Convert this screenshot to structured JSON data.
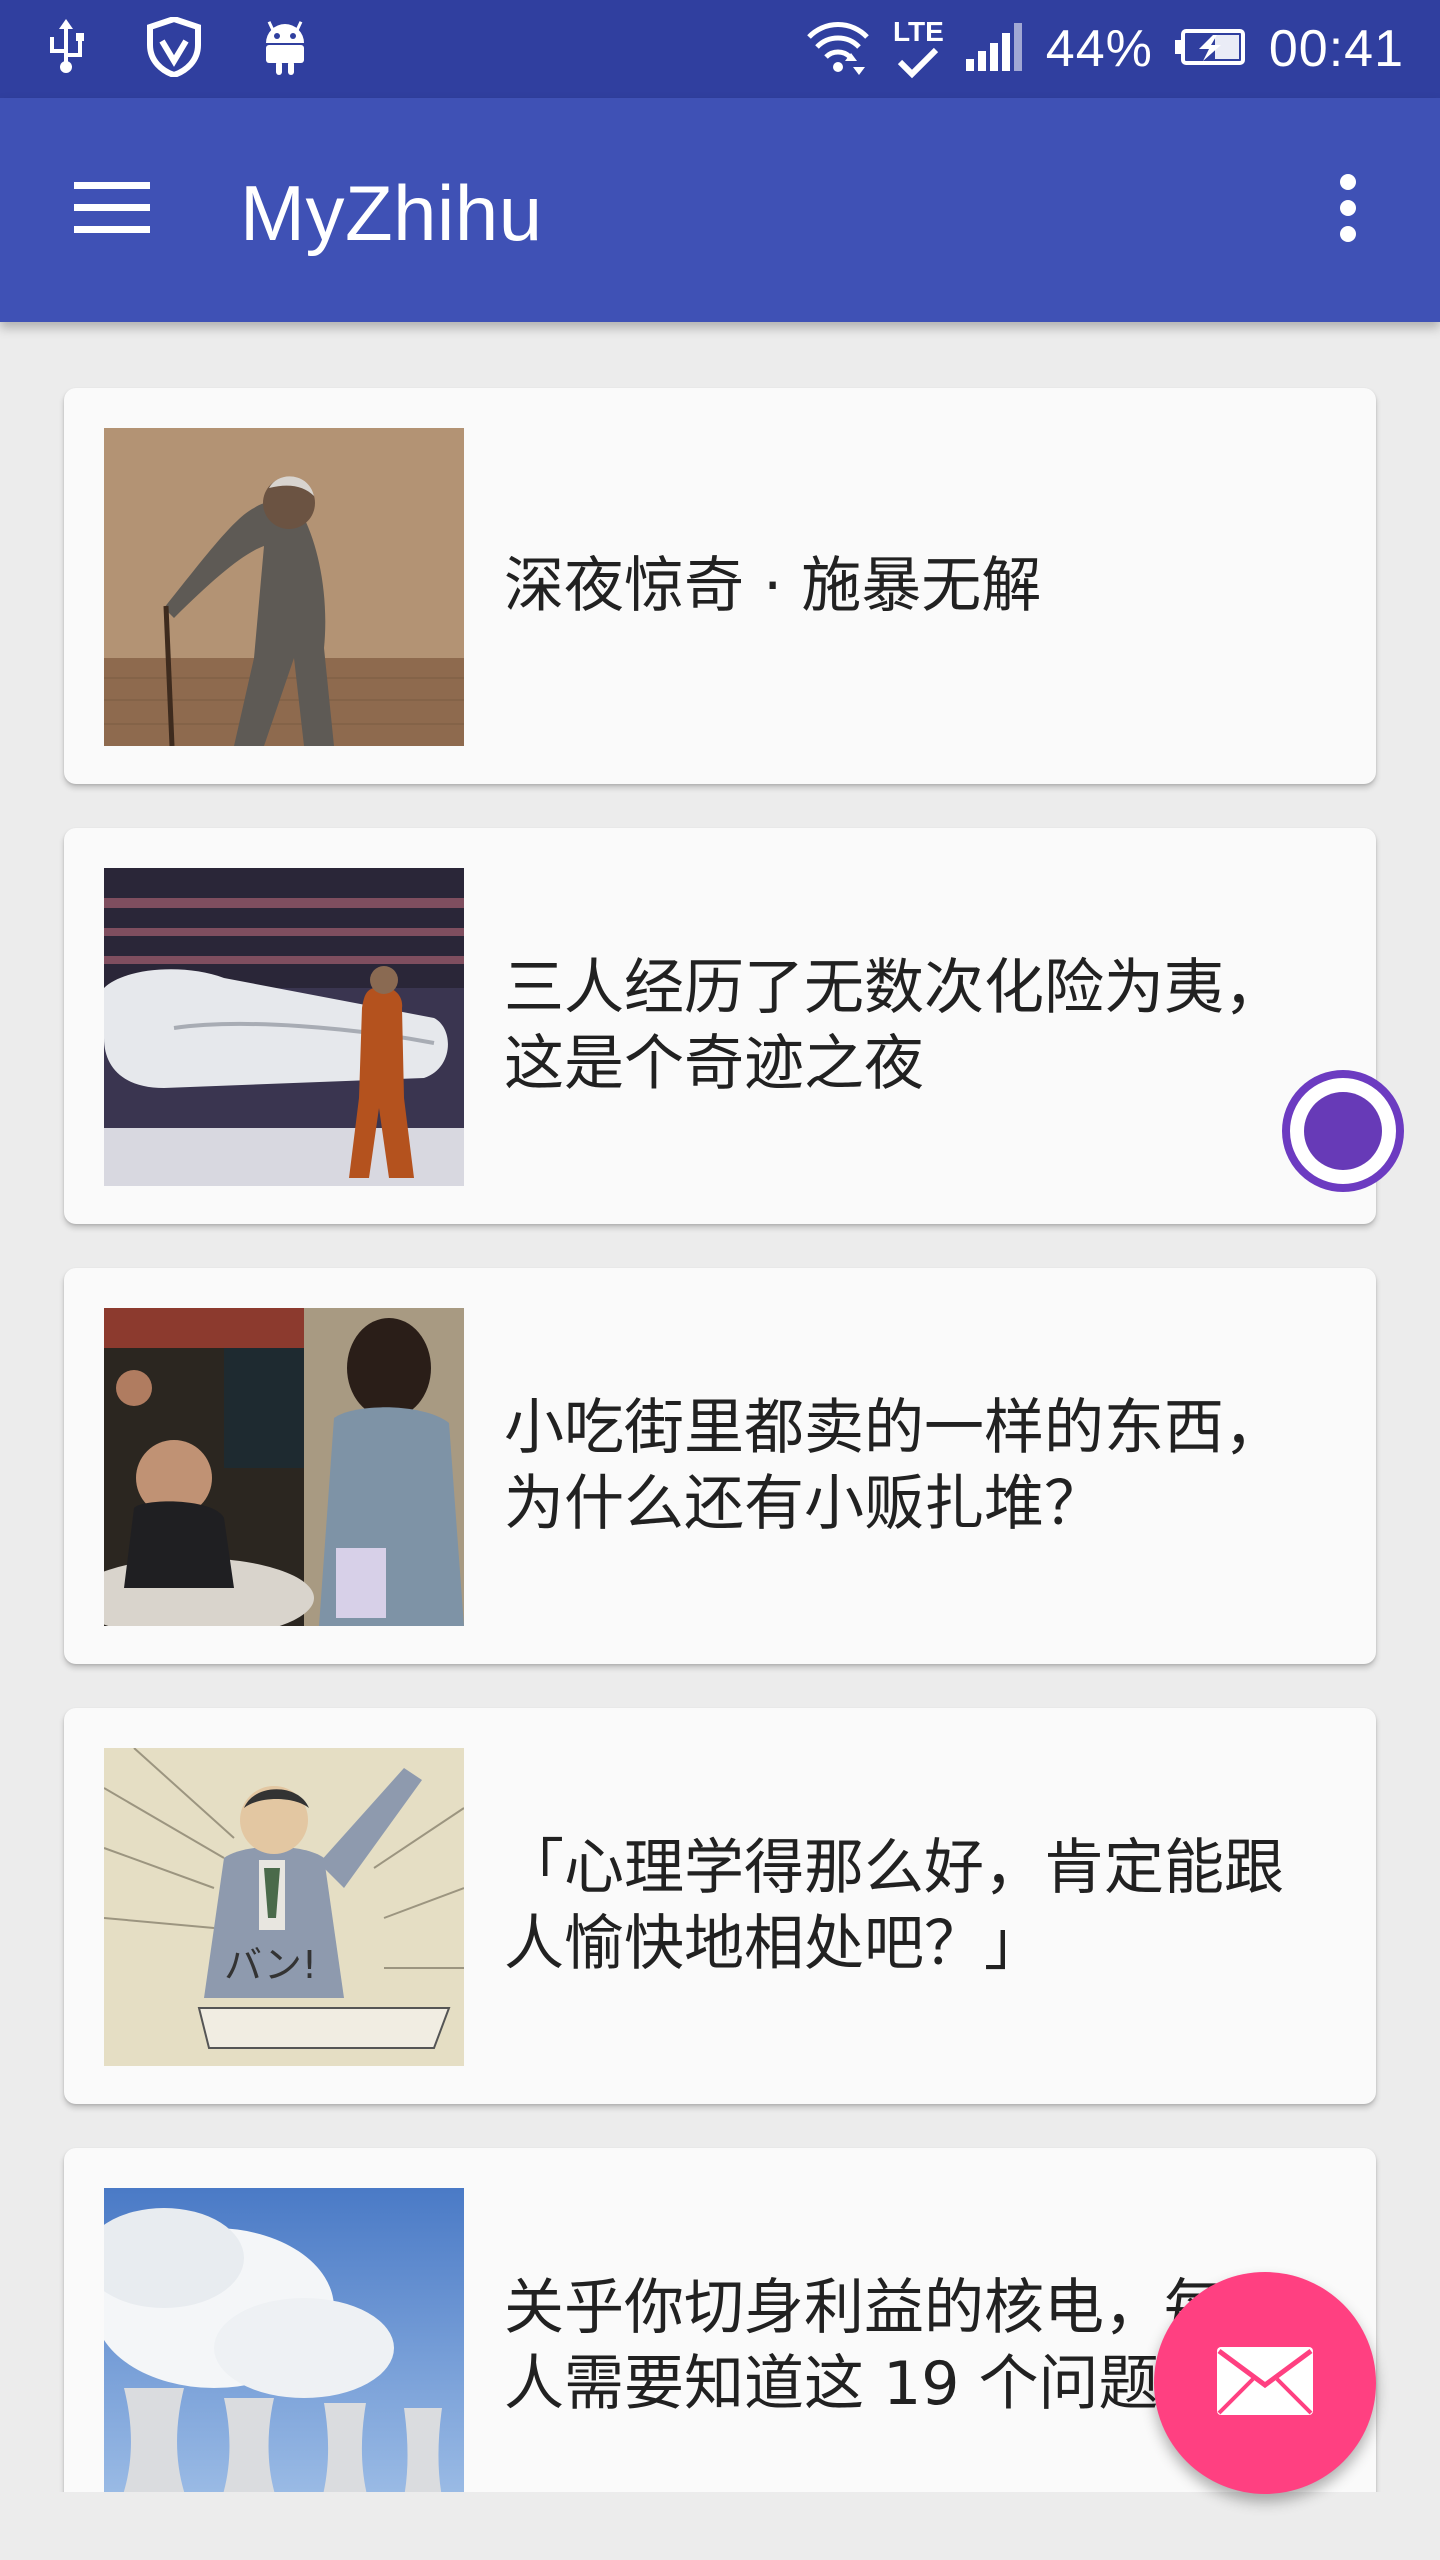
{
  "status_bar": {
    "icons_left": [
      "usb-icon",
      "shield-icon",
      "android-icon"
    ],
    "network": "LTE",
    "battery": "44%",
    "time": "00:41"
  },
  "app_bar": {
    "title": "MyZhihu",
    "menu_icon": "menu-icon",
    "overflow_icon": "more-vert-icon"
  },
  "stories": [
    {
      "title": "深夜惊奇 · 施暴无解"
    },
    {
      "title": "三人经历了无数次化险为夷，\n这是个奇迹之夜"
    },
    {
      "title": "小吃街里都卖的一样的东西，\n为什么还有小贩扎堆？"
    },
    {
      "title": "「心理学得那么好，肯定能跟\n人愉快地相处吧？」"
    },
    {
      "title": "关乎你切身利益的核电，每个\n人需要知道这 19 个问题"
    }
  ],
  "fab": {
    "icon": "mail-icon"
  },
  "colors": {
    "primary": "#3F51B5",
    "primary_dark": "#303F9F",
    "accent": "#FF4081",
    "floating_dot": "#673AB7"
  }
}
